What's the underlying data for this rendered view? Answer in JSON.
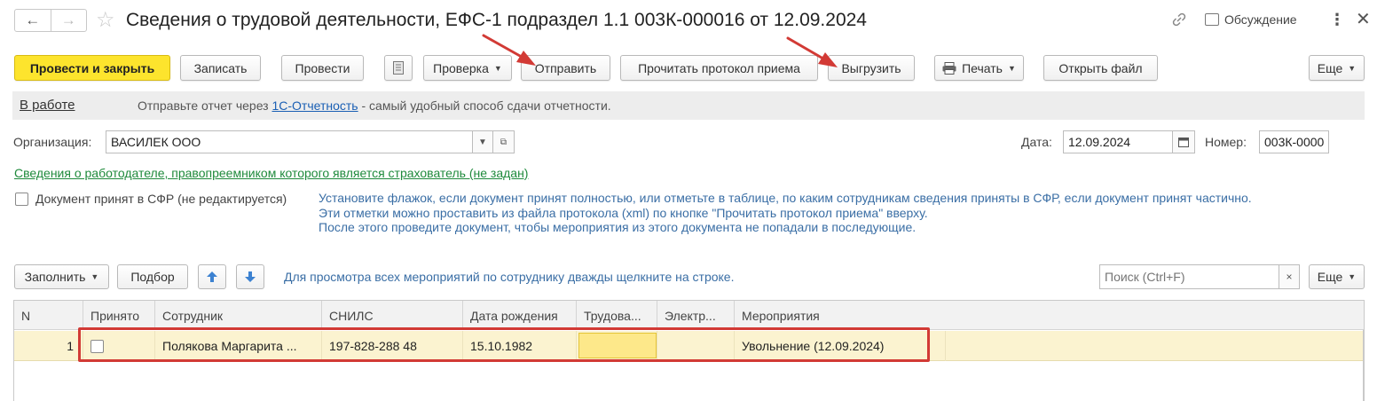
{
  "window": {
    "title": "Сведения о трудовой деятельности, ЕФС-1 подраздел 1.1 003К-000016 от 12.09.2024",
    "discuss_label": "Обсуждение",
    "more_icon": "more-vertical-icon",
    "close_icon": "close-icon"
  },
  "toolbar": {
    "post_close": "Провести и закрыть",
    "save": "Записать",
    "post": "Провести",
    "check": "Проверка",
    "send": "Отправить",
    "read_protocol": "Прочитать протокол приема",
    "export": "Выгрузить",
    "print": "Печать",
    "open_file": "Открыть файл",
    "more": "Еще"
  },
  "status": {
    "state": "В работе",
    "hint_before": "Отправьте отчет через ",
    "hint_link": "1С-Отчетность",
    "hint_after": " - самый удобный способ сдачи отчетности."
  },
  "form": {
    "org_label": "Организация:",
    "org_value": "ВАСИЛЕК ООО",
    "date_label": "Дата:",
    "date_value": "12.09.2024",
    "number_label": "Номер:",
    "number_value": "003К-0000",
    "employer_link": "Сведения о работодателе, правопреемником которого является страхователь (не задан)",
    "accepted_label": "Документ принят в СФР (не редактируется)",
    "info_line1": "Установите флажок, если документ принят полностью, или отметьте в таблице, по каким сотрудникам сведения приняты в СФР, если документ принят частично.",
    "info_line2": "Эти отметки можно проставить из файла протокола (xml) по кнопке \"Прочитать протокол приема\" вверху.",
    "info_line3": "После этого проведите документ, чтобы мероприятия из этого документа не попадали в последующие."
  },
  "table_toolbar": {
    "fill": "Заполнить",
    "pick": "Подбор",
    "tip": "Для просмотра всех мероприятий по сотруднику дважды щелкните на строке.",
    "search_placeholder": "Поиск (Ctrl+F)",
    "more": "Еще"
  },
  "table": {
    "columns": [
      "N",
      "Принято",
      "Сотрудник",
      "СНИЛС",
      "Дата рождения",
      "Трудова...",
      "Электр...",
      "Мероприятия"
    ],
    "rows": [
      {
        "n": "1",
        "accepted": false,
        "employee": "Полякова Маргарита ...",
        "snils": "197-828-288 48",
        "birth_date": "15.10.1982",
        "labor": "",
        "electronic": "",
        "events": "Увольнение (12.09.2024)"
      }
    ]
  },
  "colors": {
    "primary_button": "#fde42d",
    "annotation_red": "#d23a35",
    "row_highlight": "#fbf3d0",
    "link_blue": "#1a5fb4",
    "link_green": "#1f8a3c"
  }
}
